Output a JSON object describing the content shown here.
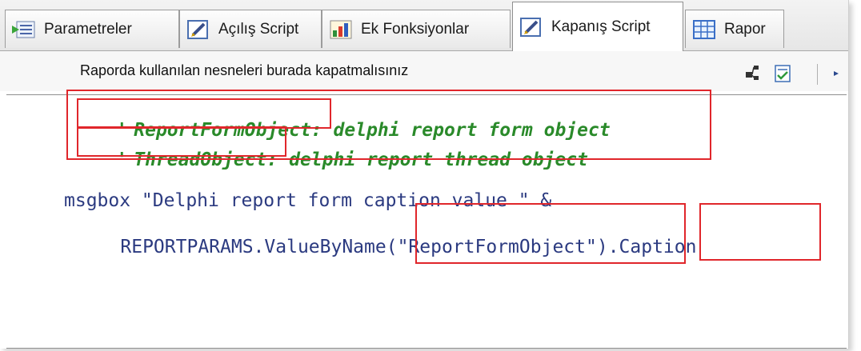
{
  "tabs": [
    {
      "label": "Parametreler",
      "icon": "list-arrow-icon",
      "active": false
    },
    {
      "label": "Açılış Script",
      "icon": "script-edit-icon",
      "active": false
    },
    {
      "label": "Ek Fonksiyonlar",
      "icon": "chart-functions-icon",
      "active": false
    },
    {
      "label": "Kapanış Script",
      "icon": "script-edit-icon",
      "active": true
    },
    {
      "label": "Rapor",
      "icon": "grid-table-icon",
      "active": false
    }
  ],
  "toolbar": {
    "hint": "Raporda kullanılan nesneleri burada kapatmalısınız",
    "icons": [
      "object-tree-icon",
      "checklist-icon",
      "run-arrow-icon"
    ]
  },
  "code": {
    "line1_quote": "'",
    "line1_name": "ReportFormObject:",
    "line1_rest": " delphi report form object",
    "line2_quote": "'",
    "line2_name": "ThreadObject:",
    "line2_rest": " delphi report thread object",
    "line3": "msgbox \"Delphi report form caption value \" &",
    "line4_a": "REPORTPARAMS.ValueByName",
    "line4_b": "(\"ReportFormObject\")",
    "line4_c": ".",
    "line4_d": "Caption"
  },
  "colors": {
    "comment": "#2a8a2a",
    "code": "#2b3a80",
    "highlight": "#e0262b"
  }
}
